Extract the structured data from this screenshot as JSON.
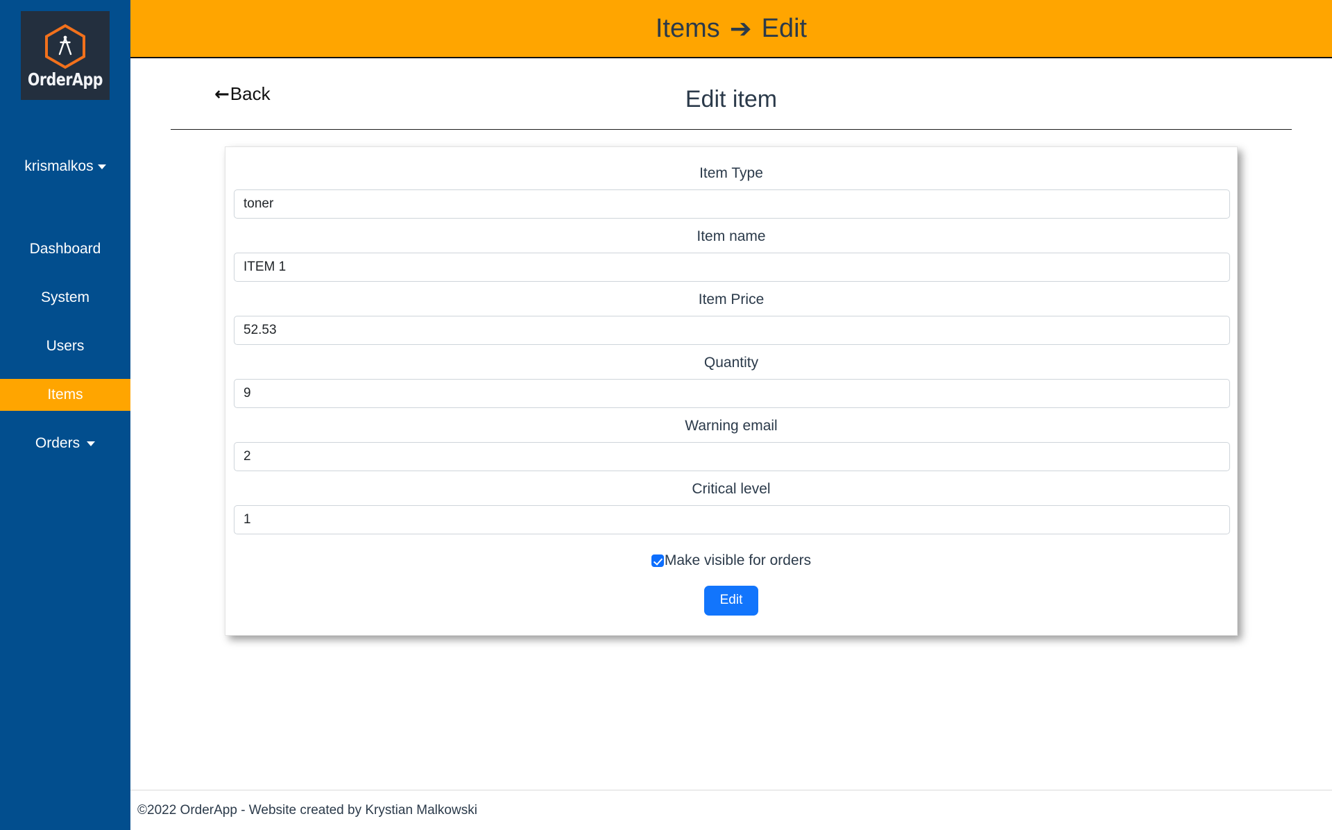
{
  "brand": {
    "logo_text": "OrderApp",
    "logo_icon": "compass-hexagon-icon",
    "hex_color": "#F2711C",
    "logo_bg": "#232F3E"
  },
  "sidebar": {
    "bg_color": "#024E8E",
    "active_color": "#FFA500",
    "user": {
      "name": "krismalkos",
      "caret_icon": "chevron-down-icon"
    },
    "items": [
      {
        "label": "Dashboard",
        "active": false,
        "has_caret": false
      },
      {
        "label": "System",
        "active": false,
        "has_caret": false
      },
      {
        "label": "Users",
        "active": false,
        "has_caret": false
      },
      {
        "label": "Items",
        "active": true,
        "has_caret": false
      },
      {
        "label": "Orders",
        "active": false,
        "has_caret": true
      }
    ]
  },
  "topbar": {
    "bg_color": "#FFA500",
    "breadcrumb_parent": "Items",
    "breadcrumb_arrow": "➔",
    "breadcrumb_current": "Edit"
  },
  "page": {
    "back_arrow": "←",
    "back_label": "Back",
    "title": "Edit item"
  },
  "form": {
    "fields": [
      {
        "label": "Item Type",
        "value": "toner",
        "name": "item-type"
      },
      {
        "label": "Item name",
        "value": "ITEM 1",
        "name": "item-name"
      },
      {
        "label": "Item Price",
        "value": "52.53",
        "name": "item-price"
      },
      {
        "label": "Quantity",
        "value": "9",
        "name": "quantity"
      },
      {
        "label": "Warning email",
        "value": "2",
        "name": "warning-email"
      },
      {
        "label": "Critical level",
        "value": "1",
        "name": "critical-level"
      }
    ],
    "checkbox": {
      "label": "Make visible for orders",
      "checked": true
    },
    "submit_label": "Edit",
    "submit_color": "#1275FC"
  },
  "footer": {
    "text": "©2022 OrderApp - Website created by Krystian Malkowski"
  }
}
